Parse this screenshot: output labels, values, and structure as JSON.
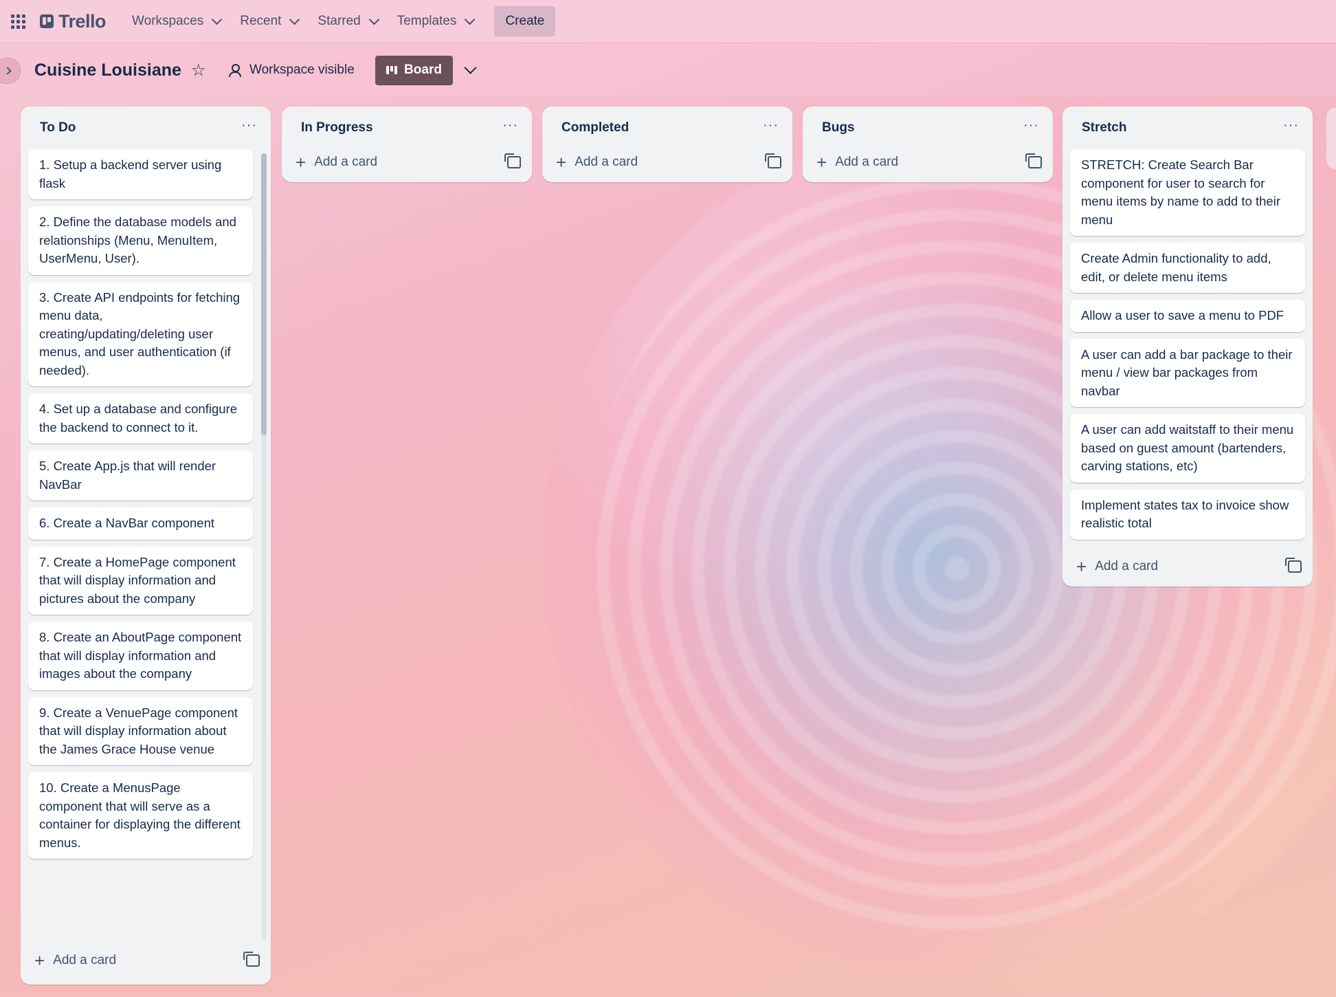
{
  "header": {
    "logo_text": "Trello",
    "nav": [
      {
        "label": "Workspaces"
      },
      {
        "label": "Recent"
      },
      {
        "label": "Starred"
      },
      {
        "label": "Templates"
      }
    ],
    "create_label": "Create"
  },
  "board": {
    "title": "Cuisine Louisiane",
    "visibility_label": "Workspace visible",
    "view_label": "Board"
  },
  "add_card_label": "Add a card",
  "lists": {
    "todo": {
      "title": "To Do",
      "cards": [
        "1. Setup a backend server using flask",
        "2. Define the database models and relationships (Menu, MenuItem, UserMenu, User).",
        "3. Create API endpoints for fetching menu data, creating/updating/deleting user menus, and user authentication (if needed).",
        "4. Set up a database and configure the backend to connect to it.",
        "5. Create App.js that will render NavBar",
        "6. Create a NavBar component",
        "7. Create a HomePage component that will display information and pictures about the company",
        "8. Create an AboutPage component that will display information and images about the company",
        "9. Create a VenuePage component that will display information about the James Grace House venue",
        "10. Create a MenusPage component that will serve as a container for displaying the different menus."
      ]
    },
    "in_progress": {
      "title": "In Progress"
    },
    "completed": {
      "title": "Completed"
    },
    "bugs": {
      "title": "Bugs"
    },
    "stretch": {
      "title": "Stretch",
      "cards": [
        "STRETCH: Create Search Bar component for user to search for menu items by name to add to their menu",
        "Create Admin functionality to add, edit, or delete menu items",
        "Allow a user to save a menu to PDF",
        "A user can add a bar package to their menu / view bar packages from navbar",
        "A user can add waitstaff to their menu based on guest amount (bartenders, carving stations, etc)",
        "Implement states tax to invoice show realistic total"
      ]
    }
  },
  "icons": {
    "apps": "grid-icon",
    "star": "star-icon",
    "visibility": "people-icon",
    "board_view": "board-icon",
    "list_menu": "ellipsis-icon",
    "add": "plus-icon",
    "template": "template-icon"
  }
}
